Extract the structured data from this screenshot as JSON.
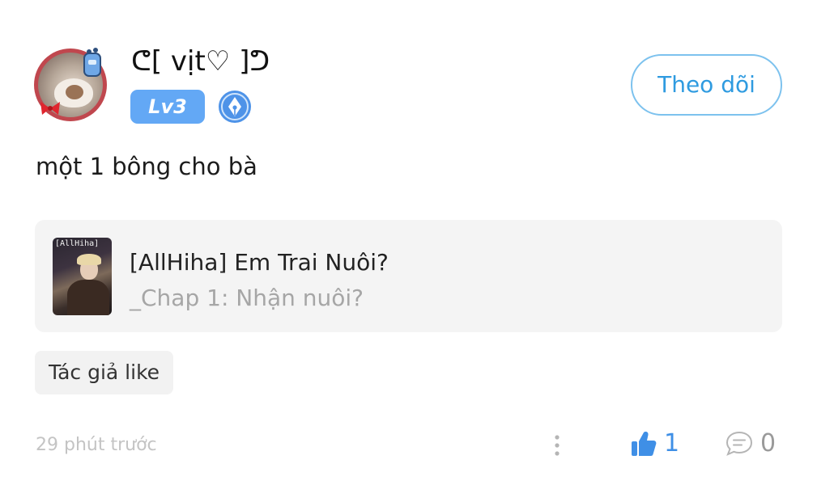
{
  "post": {
    "author": {
      "name": "ᕦ[ vịt♡ ]ᕤ",
      "level": "Lv3"
    },
    "follow_label": "Theo dõi",
    "text": "một 1 bông cho bà",
    "story": {
      "cover_text": "[AllHiha]",
      "title": "[AllHiha] Em Trai Nuôi?",
      "chapter": "_Chap 1: Nhận nuôi?"
    },
    "tag": "Tác giả like",
    "timestamp": "29 phút trước",
    "likes": "1",
    "comments": "0"
  },
  "icons": {
    "author_badge": "pen-nib-icon",
    "more": "more-vertical-icon",
    "like": "thumbs-up-icon",
    "comment": "comment-bubble-icon"
  },
  "colors": {
    "accent": "#2f9be0",
    "level_badge": "#63a8f5",
    "like": "#3f8fe6",
    "muted": "#a6a6a6"
  }
}
